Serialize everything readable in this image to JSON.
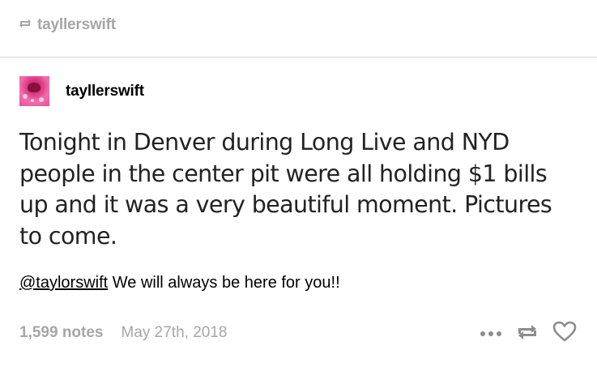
{
  "reblog": {
    "username": "tayllerswift",
    "icon": "reblog-icon"
  },
  "post": {
    "author": "tayllerswift",
    "avatar_icon": "avatar-image",
    "body": "Tonight in Denver during Long Live and NYD people in the center pit were all holding $1 bills up and it was a very beautiful moment. Pictures to come.",
    "caption": {
      "mention": "@taylorswift",
      "text": " We will always be here for you!!"
    }
  },
  "footer": {
    "notes": "1,599 notes",
    "date": "May 27th, 2018",
    "icons": [
      "more-icon",
      "reblog-icon",
      "heart-icon"
    ]
  },
  "colors": {
    "muted": "#a6a6a6",
    "divider": "#d9d9d9",
    "icon": "#8c8c8c"
  }
}
